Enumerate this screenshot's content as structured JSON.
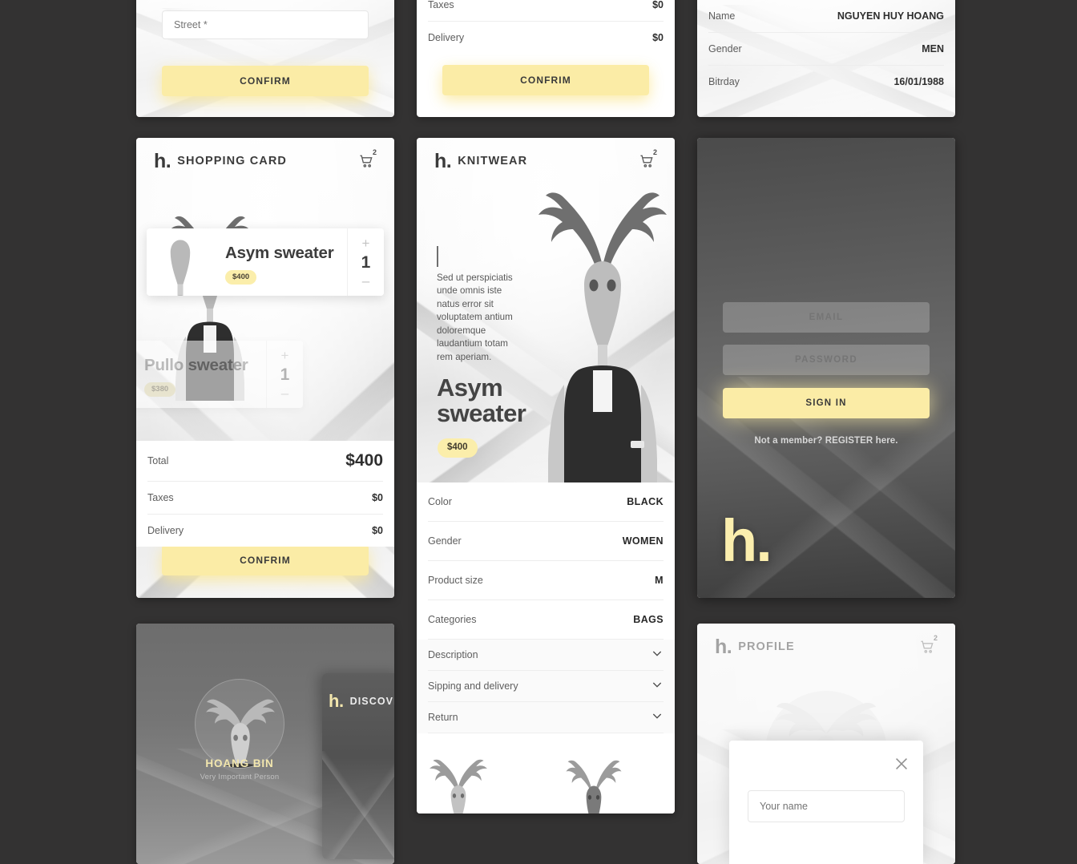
{
  "brand": {
    "logo": "h.",
    "accent_yellow": "#FBECA6",
    "pill_yellow": "#FBEEAB",
    "bg_dark": "#333232",
    "text_dark": "#3B3B3B"
  },
  "cards": {
    "address_top": {
      "name": "address-form-card",
      "street_placeholder": "Street *",
      "confirm_label": "CONFIRM"
    },
    "checkout_top": {
      "name": "checkout-summary-card",
      "rows": [
        {
          "label": "Taxes",
          "value": "$0"
        },
        {
          "label": "Delivery",
          "value": "$0"
        }
      ],
      "confirm_label": "CONFRIM"
    },
    "profile_info_top": {
      "name": "profile-info-card",
      "rows": [
        {
          "label": "Name",
          "value": "NGUYEN HUY HOANG"
        },
        {
          "label": "Gender",
          "value": "MEN"
        },
        {
          "label": "Bitrday",
          "value": "16/01/1988"
        }
      ]
    },
    "shopping": {
      "name": "shopping-card",
      "title": "SHOPPING CARD",
      "cart_badge": "2",
      "items": [
        {
          "name": "Asym sweater",
          "price": "$400",
          "qty": "1",
          "plus": "+",
          "minus": "–"
        },
        {
          "name": "Pullo sweater",
          "price": "$380",
          "qty": "1",
          "plus": "+",
          "minus": "–"
        }
      ],
      "totals": [
        {
          "label": "Total",
          "value": "$400"
        },
        {
          "label": "Taxes",
          "value": "$0"
        },
        {
          "label": "Delivery",
          "value": "$0"
        }
      ],
      "confirm_label": "CONFRIM"
    },
    "product": {
      "name": "product-detail-card",
      "title": "KNITWEAR",
      "cart_badge": "2",
      "lorem": "Sed ut perspiciatis unde omnis iste natus error sit voluptatem antium doloremque laudantium totam rem aperiam.",
      "product_name": "Asym sweater",
      "price": "$400",
      "attributes": [
        {
          "key": "Color",
          "value": "BLACK"
        },
        {
          "key": "Gender",
          "value": "WOMEN"
        },
        {
          "key": "Product size",
          "value": "M"
        },
        {
          "key": "Categories",
          "value": "BAGS"
        }
      ],
      "accordions": [
        {
          "label": "Description"
        },
        {
          "label": "Sipping and delivery"
        },
        {
          "label": "Return"
        }
      ]
    },
    "signin": {
      "name": "sign-in-card",
      "email_placeholder": "EMAIL",
      "password_placeholder": "PASSWORD",
      "signin_label": "SIGN IN",
      "register_text": "Not a member? REGISTER here.",
      "logo": "h."
    },
    "discover": {
      "name": "vip-discover-card",
      "vip_name": "HOANG BIN",
      "vip_subtitle": "Very Important Person",
      "panel_logo": "h.",
      "panel_title": "DISCOVER"
    },
    "profile": {
      "name": "profile-card",
      "title": "PROFILE",
      "cart_badge": "2",
      "name_placeholder": "Your name"
    }
  },
  "icons": {
    "cart": "shopping-cart-icon",
    "chevron": "chevron-down-icon",
    "close": "close-icon"
  }
}
